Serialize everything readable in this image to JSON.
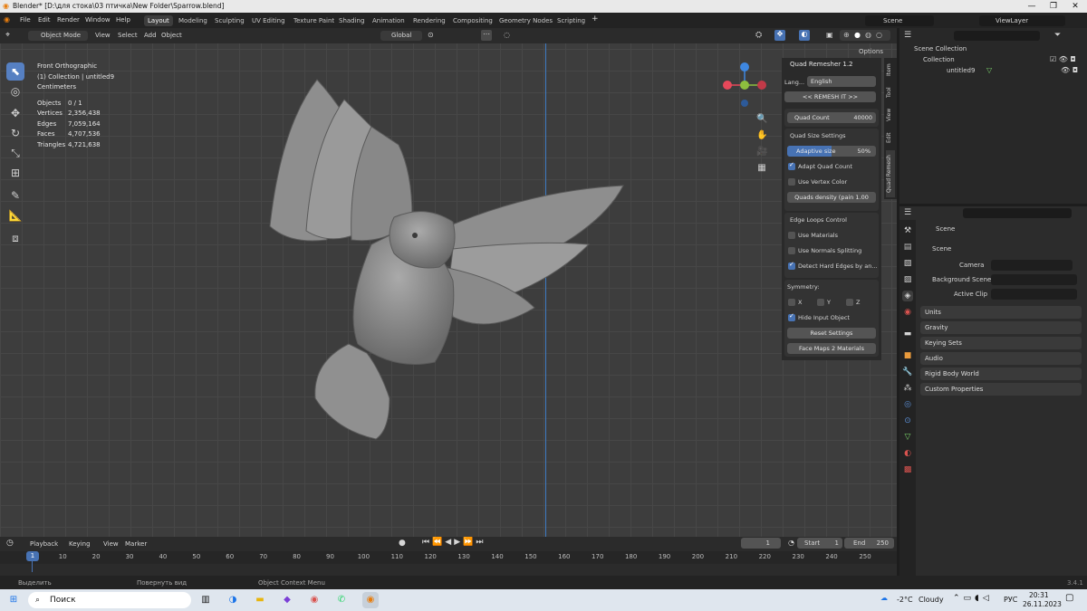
{
  "window": {
    "title": "Blender* [D:\\для стока\\03 птичка\\New Folder\\Sparrow.blend]",
    "minimize": "—",
    "maximize": "❐",
    "close": "✕"
  },
  "menu": [
    "File",
    "Edit",
    "Render",
    "Window",
    "Help"
  ],
  "workspaces": [
    "Layout",
    "Modeling",
    "Sculpting",
    "UV Editing",
    "Texture Paint",
    "Shading",
    "Animation",
    "Rendering",
    "Compositing",
    "Geometry Nodes",
    "Scripting"
  ],
  "active_workspace": "Layout",
  "scene_selector": "Scene",
  "view_layer": "ViewLayer",
  "viewport_header": {
    "mode": "Object Mode",
    "menus": [
      "View",
      "Select",
      "Add",
      "Object"
    ],
    "orientation": "Global",
    "options": "Options"
  },
  "overlay_text": {
    "view_name": "Front Orthographic",
    "collection": "(1) Collection | untitled9",
    "units": "Centimeters",
    "stats": [
      {
        "label": "Objects",
        "value": "0 / 1"
      },
      {
        "label": "Vertices",
        "value": "2,356,438"
      },
      {
        "label": "Edges",
        "value": "7,059,164"
      },
      {
        "label": "Faces",
        "value": "4,707,536"
      },
      {
        "label": "Triangles",
        "value": "4,721,638"
      }
    ]
  },
  "quad_remesher": {
    "title": "Quad Remesher 1.2",
    "lang_label": "Lang...",
    "lang_value": "English",
    "remesh_button": "<< REMESH IT >>",
    "quad_count_label": "Quad Count",
    "quad_count_value": "40000",
    "quad_size_title": "Quad Size Settings",
    "adaptive_label": "Adaptive size",
    "adaptive_value": "50%",
    "adaptive_fraction": 0.5,
    "adapt_quad_count": "Adapt Quad Count",
    "use_vertex_color": "Use Vertex Color",
    "quads_density": "Quads density (pain  1.00",
    "edge_loops_title": "Edge Loops Control",
    "use_materials": "Use Materials",
    "use_normals_splitting": "Use Normals Splitting",
    "detect_hard_edges": "Detect Hard Edges by an...",
    "symmetry_title": "Symmetry:",
    "sym_x": "X",
    "sym_y": "Y",
    "sym_z": "Z",
    "hide_input": "Hide Input Object",
    "reset_settings": "Reset Settings",
    "face_maps": "Face Maps 2 Materials"
  },
  "side_tabs": [
    "Item",
    "Tool",
    "View",
    "Edit",
    "Quad Remesh"
  ],
  "outliner": {
    "root": "Scene Collection",
    "collection": "Collection",
    "object": "untitled9"
  },
  "properties": {
    "breadcrumb": "Scene",
    "scene_section": "Scene",
    "camera_label": "Camera",
    "background_scene_label": "Background Scene",
    "active_clip_label": "Active Clip",
    "sections": [
      "Units",
      "Gravity",
      "Keying Sets",
      "Audio",
      "Rigid Body World",
      "Custom Properties"
    ]
  },
  "timeline": {
    "menus": [
      "Playback",
      "Keying",
      "View",
      "Marker"
    ],
    "current_frame": "1",
    "start_label": "Start",
    "start_value": "1",
    "end_label": "End",
    "end_value": "250",
    "ticks": [
      "1",
      "10",
      "20",
      "30",
      "40",
      "50",
      "60",
      "70",
      "80",
      "90",
      "100",
      "110",
      "120",
      "130",
      "140",
      "150",
      "160",
      "170",
      "180",
      "190",
      "200",
      "210",
      "220",
      "230",
      "240",
      "250"
    ],
    "playhead_label": "1"
  },
  "status": {
    "select": "Выделить",
    "rotate": "Повернуть вид",
    "context": "Object Context Menu",
    "version": "3.4.1"
  },
  "taskbar": {
    "search": "Поиск",
    "temp": "-2°C",
    "weather": "Cloudy",
    "lang": "РУС",
    "time": "20:31",
    "date": "26.11.2023"
  },
  "colors": {
    "accent": "#4772b3",
    "axis_x": "#e8485a",
    "axis_y": "#8dbf3e",
    "axis_z": "#3e87e0"
  }
}
